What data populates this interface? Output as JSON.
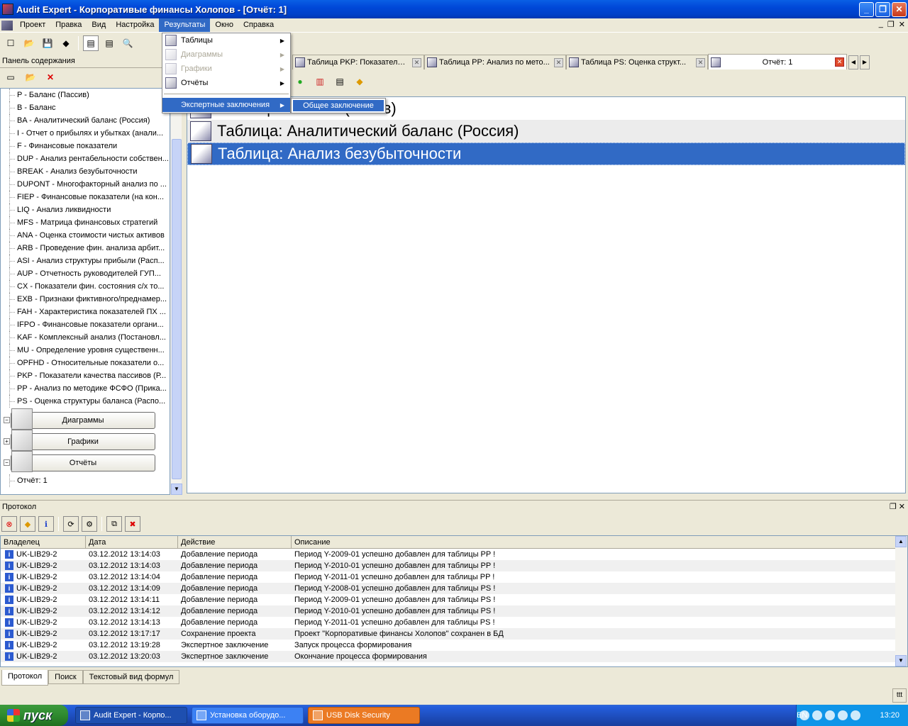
{
  "window": {
    "title": "Audit Expert - Корпоративые финансы Холопов  - [Отчёт: 1]"
  },
  "menubar": [
    "Проект",
    "Правка",
    "Вид",
    "Настройка",
    "Результаты",
    "Окно",
    "Справка"
  ],
  "left_panel": {
    "header": "Панель содержания",
    "tree_items": [
      "P - Баланс (Пассив)",
      "B - Баланс",
      "BA - Аналитический баланс (Россия)",
      "I - Отчет о прибылях и убытках (анали...",
      "F - Финансовые показатели",
      "DUP - Анализ рентабельности собствен...",
      "BREAK - Анализ безубыточности",
      "DUPONT - Многофакторный анализ по ...",
      "FIEP - Финансовые показатели (на кон...",
      "LIQ - Анализ ликвидности",
      "MFS - Матрица финансовых стратегий",
      "ANA - Оценка стоимости чистых активов",
      "ARB - Проведение фин. анализа арбит...",
      "ASI - Анализ структуры прибыли (Расп...",
      "AUP - Отчетность руководителей ГУП...",
      "CX - Показатели фин. состояния с/х то...",
      "EXB - Признаки фиктивного/преднамер...",
      "FAH - Характеристика показателей ПХ ...",
      "IFPO - Финансовые показатели органи...",
      "KAF - Комплексный анализ (Постановл...",
      "MU - Определение уровня существенн...",
      "OPFHD - Относительные показатели о...",
      "PKP - Показатели качества пассивов (Р...",
      "PP - Анализ по методике ФСФО (Прика...",
      "PS - Оценка структуры баланса (Распо..."
    ],
    "groups": [
      "Диаграммы",
      "Графики",
      "Отчёты"
    ],
    "report_item": "Отчёт: 1"
  },
  "doc_tabs": [
    {
      "label": "Таблица PKP: Показатели к..."
    },
    {
      "label": "Таблица PP: Анализ по мето..."
    },
    {
      "label": "Таблица PS: Оценка структ..."
    },
    {
      "label": "Отчёт: 1",
      "active": true
    }
  ],
  "doc_rows": [
    "Таблица: Баланс (Актив)",
    "Таблица: Аналитический баланс (Россия)",
    "Таблица: Анализ безубыточности"
  ],
  "results_menu": {
    "items": [
      {
        "label": "Таблицы",
        "disabled": false
      },
      {
        "label": "Диаграммы",
        "disabled": true
      },
      {
        "label": "Графики",
        "disabled": true
      },
      {
        "label": "Отчёты",
        "disabled": false
      },
      {
        "label": "Экспертные заключения",
        "highlighted": true
      }
    ],
    "submenu_item": "Общее заключение"
  },
  "protocol": {
    "header": "Протокол",
    "columns": [
      "Владелец",
      "Дата",
      "Действие",
      "Описание"
    ],
    "rows": [
      [
        "UK-LIB29-2",
        "03.12.2012 13:14:03",
        "Добавление периода",
        "Период Y-2009-01 успешно добавлен для таблицы PP !"
      ],
      [
        "UK-LIB29-2",
        "03.12.2012 13:14:03",
        "Добавление периода",
        "Период Y-2010-01 успешно добавлен для таблицы PP !"
      ],
      [
        "UK-LIB29-2",
        "03.12.2012 13:14:04",
        "Добавление периода",
        "Период Y-2011-01 успешно добавлен для таблицы PP !"
      ],
      [
        "UK-LIB29-2",
        "03.12.2012 13:14:09",
        "Добавление периода",
        "Период Y-2008-01 успешно добавлен для таблицы PS !"
      ],
      [
        "UK-LIB29-2",
        "03.12.2012 13:14:11",
        "Добавление периода",
        "Период Y-2009-01 успешно добавлен для таблицы PS !"
      ],
      [
        "UK-LIB29-2",
        "03.12.2012 13:14:12",
        "Добавление периода",
        "Период Y-2010-01 успешно добавлен для таблицы PS !"
      ],
      [
        "UK-LIB29-2",
        "03.12.2012 13:14:13",
        "Добавление периода",
        "Период Y-2011-01 успешно добавлен для таблицы PS !"
      ],
      [
        "UK-LIB29-2",
        "03.12.2012 13:17:17",
        "Сохранение проекта",
        "Проект \"Корпоративые финансы Холопов\" сохранен в БД"
      ],
      [
        "UK-LIB29-2",
        "03.12.2012 13:19:28",
        "Экспертное заключение",
        "Запуск процесса формирования"
      ],
      [
        "UK-LIB29-2",
        "03.12.2012 13:20:03",
        "Экспертное заключение",
        "Окончание процесса формирования"
      ]
    ]
  },
  "bottom_tabs": [
    "Протокол",
    "Поиск",
    "Текстовый вид формул"
  ],
  "status": {
    "ttt": "ttt"
  },
  "taskbar": {
    "start": "пуск",
    "tasks": [
      "Audit Expert - Корпо...",
      "Установка оборудо...",
      "USB Disk Security"
    ],
    "lang": "EN",
    "clock": "13:20"
  }
}
